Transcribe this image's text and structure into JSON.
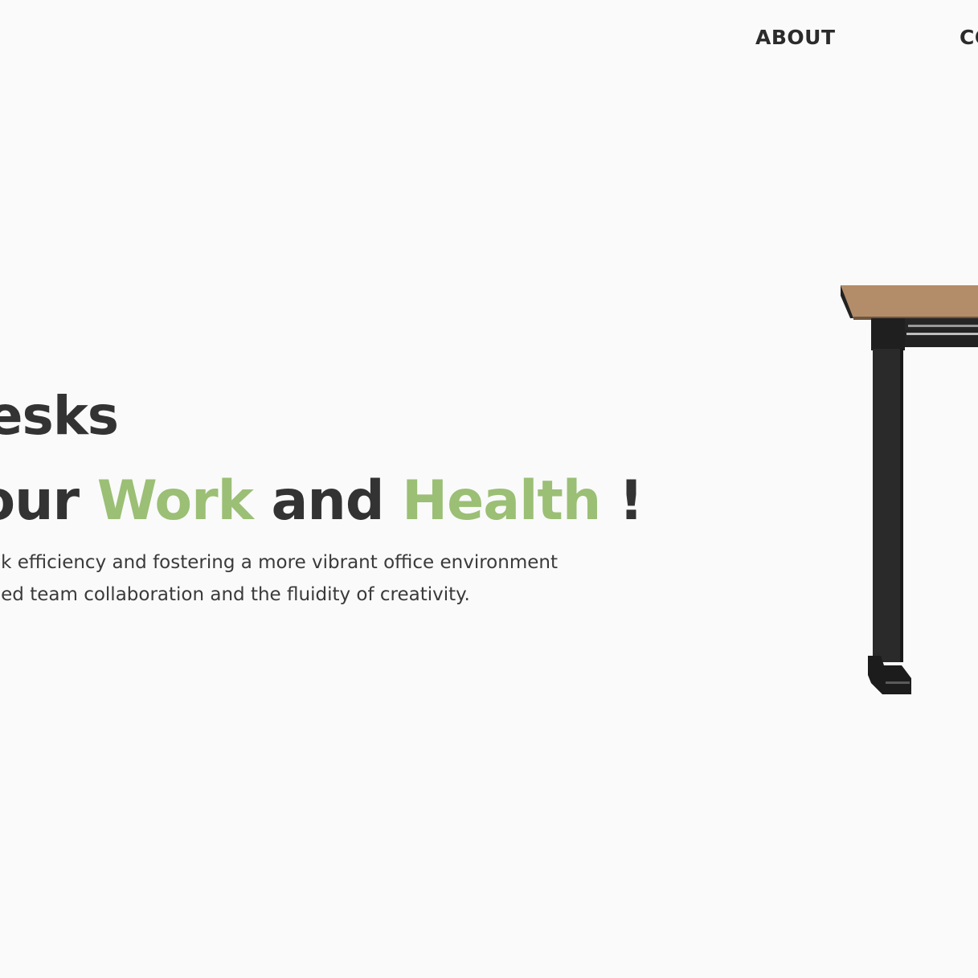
{
  "nav": {
    "about_label": "ABOUT",
    "contact_label": "CONTACT"
  },
  "hero": {
    "title": "Desks",
    "tagline_start": "ate Your ",
    "tagline_work": "Work",
    "tagline_and": " and ",
    "tagline_health": "Health",
    "tagline_end": " !",
    "desc_line1": "k efficiency and fostering a more vibrant office environment",
    "desc_line2": "ed team collaboration and the fluidity of creativity."
  },
  "colors": {
    "background": "#fafafa",
    "text": "#333333",
    "accent": "#9bbf75",
    "desk_top": "#b38c69",
    "desk_frame": "#2a2a2a"
  },
  "images": {
    "desk": "standing-desk-image"
  }
}
